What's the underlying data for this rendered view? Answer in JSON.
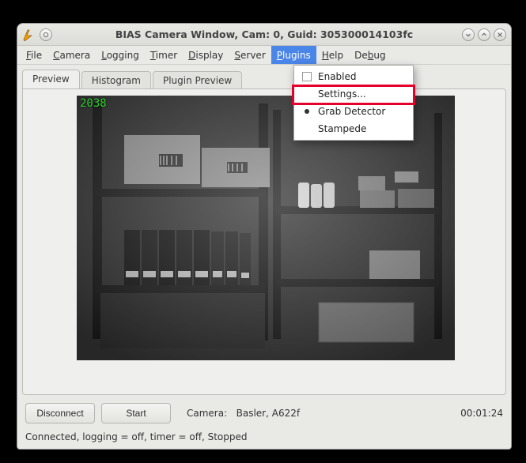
{
  "window": {
    "title": "BIAS Camera Window, Cam: 0, Guid: 305300014103fc"
  },
  "menubar": {
    "items": [
      {
        "label": "File",
        "underline_index": 0
      },
      {
        "label": "Camera",
        "underline_index": 0
      },
      {
        "label": "Logging",
        "underline_index": 0
      },
      {
        "label": "Timer",
        "underline_index": 0
      },
      {
        "label": "Display",
        "underline_index": 0
      },
      {
        "label": "Server",
        "underline_index": 0
      },
      {
        "label": "Plugins",
        "underline_index": 0,
        "active": true
      },
      {
        "label": "Help",
        "underline_index": 0
      },
      {
        "label": "Debug",
        "underline_index": 2
      }
    ]
  },
  "plugins_menu": {
    "enabled": "Enabled",
    "settings": "Settings...",
    "grab_detector": "Grab Detector",
    "stampede": "Stampede",
    "highlight": "settings"
  },
  "tabs": {
    "items": [
      "Preview",
      "Histogram",
      "Plugin Preview"
    ],
    "active_index": 0
  },
  "preview": {
    "frame_counter": "2038"
  },
  "controls": {
    "disconnect": "Disconnect",
    "start": "Start"
  },
  "camera": {
    "label_prefix": "Camera:",
    "value": "Basler, A622f"
  },
  "elapsed": "00:01:24",
  "status_line": "Connected, logging = off, timer = off, Stopped"
}
